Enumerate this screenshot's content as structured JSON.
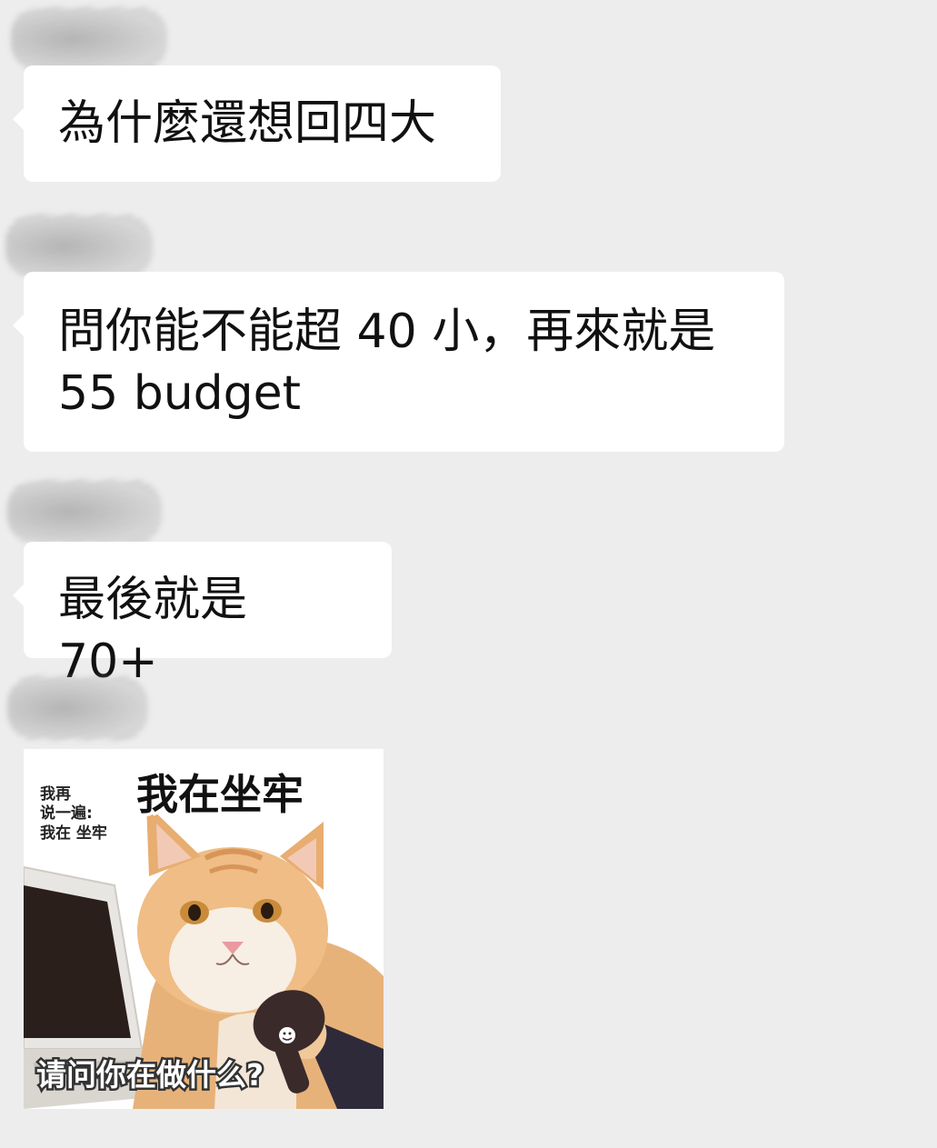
{
  "chat": {
    "messages": [
      {
        "type": "text",
        "text": "為什麼還想回四大"
      },
      {
        "type": "text",
        "text": "問你能不能超 40 小，再來就是\n55 budget"
      },
      {
        "type": "text",
        "text": "最後就是 70+"
      },
      {
        "type": "sticker",
        "subject": "orange tabby cat with laptop and microphone",
        "captions": {
          "top_big": "我在坐牢",
          "side_line1": "我再",
          "side_line2": "说一遍:",
          "side_line3": "我在 坐牢",
          "bottom": "请问你在做什么?"
        }
      }
    ]
  },
  "colors": {
    "background": "#ededed",
    "bubble": "#ffffff",
    "text": "#111111"
  }
}
